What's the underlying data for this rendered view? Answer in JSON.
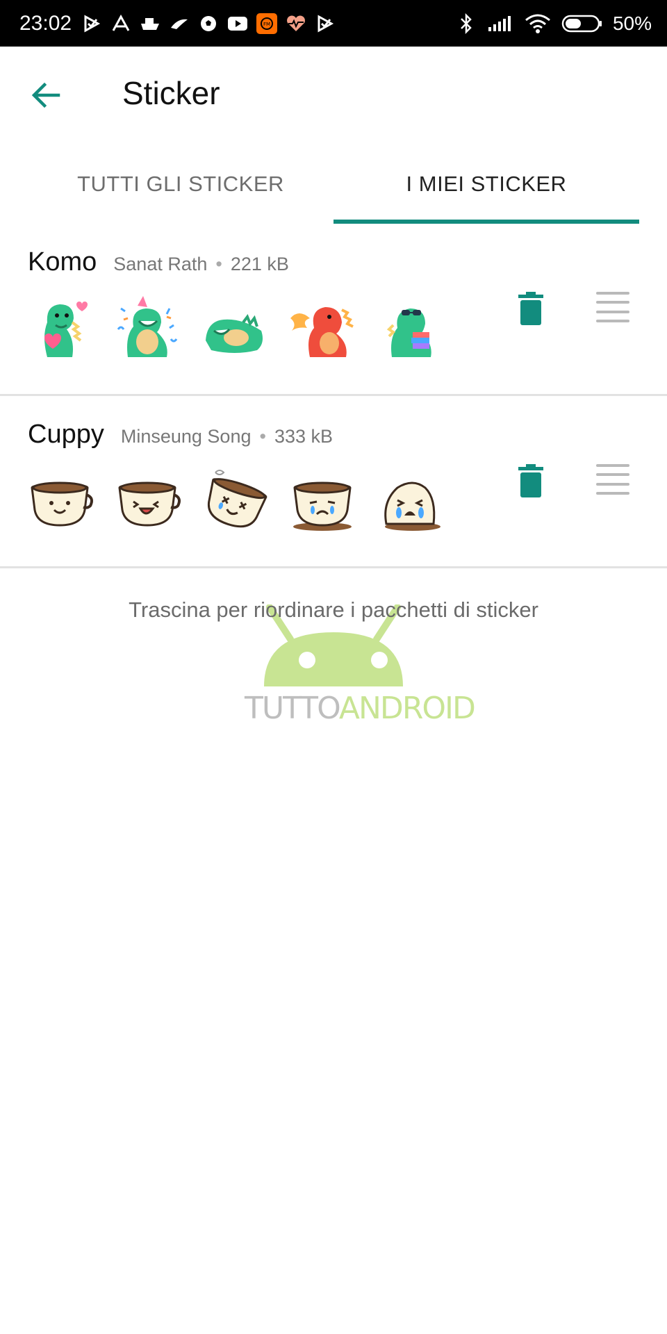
{
  "status_bar": {
    "time": "23:02",
    "battery_text": "50%",
    "battery_level": 0.5,
    "left_icons": [
      "play-store-check-icon",
      "alert-a-icon",
      "ship-icon",
      "bird-icon",
      "soccer-ball-icon",
      "youtube-icon",
      "fm-radio-icon",
      "heart-pulse-icon",
      "play-store-check-icon"
    ],
    "right_icons": [
      "bluetooth-icon",
      "signal-icon",
      "wifi-icon",
      "battery-icon"
    ]
  },
  "app_bar": {
    "title": "Sticker",
    "back_icon": "arrow-left-icon"
  },
  "tabs": [
    {
      "label": "TUTTI GLI STICKER",
      "selected": false
    },
    {
      "label": "I MIEI STICKER",
      "selected": true
    }
  ],
  "packs": [
    {
      "name": "Komo",
      "author": "Sanat Rath",
      "separator": "•",
      "size": "221 kB",
      "stickers": [
        "dino-heart-sticker",
        "dino-party-sticker",
        "dino-lying-sticker",
        "dino-fire-sticker",
        "dino-books-sticker"
      ]
    },
    {
      "name": "Cuppy",
      "author": "Minseung Song",
      "separator": "•",
      "size": "333 kB",
      "stickers": [
        "cup-smile-sticker",
        "cup-laugh-sticker",
        "cup-dizzy-sticker",
        "cup-sad-sticker",
        "cup-cry-sticker"
      ]
    }
  ],
  "hint_text": "Trascina per riordinare i pacchetti di sticker",
  "watermark": {
    "part1": "TUTTO",
    "part2": "ANDROID"
  },
  "colors": {
    "accent": "#128c7e",
    "tab_inactive": "#6d6d6d",
    "divider": "#e2e2e2",
    "watermark_green": "#9ccf3c"
  }
}
